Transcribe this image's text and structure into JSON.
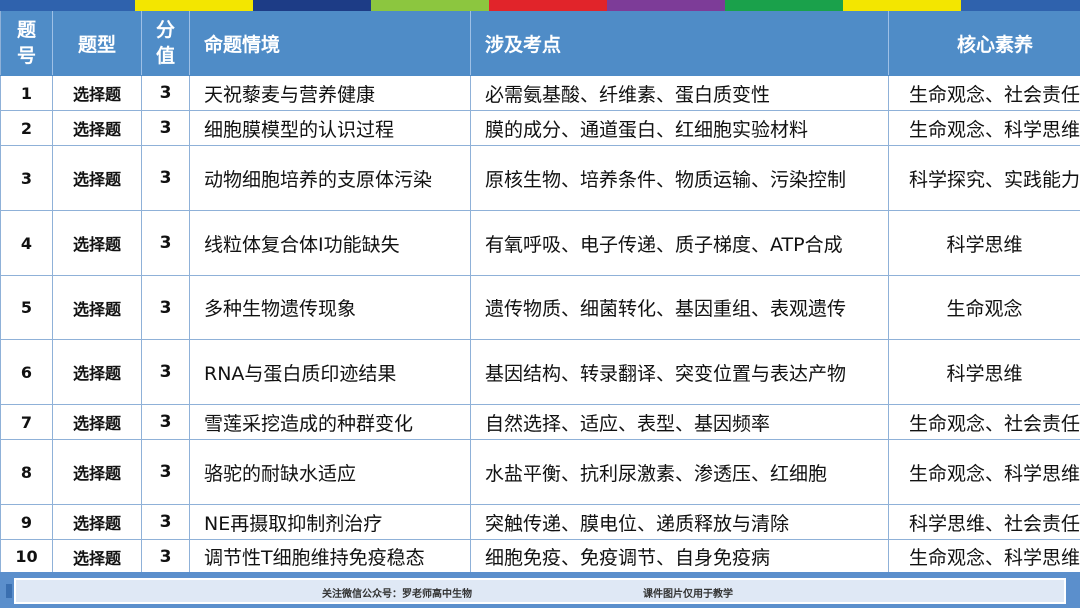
{
  "color_bar": [
    "#2f62ad",
    "#f3e600",
    "#1d3c86",
    "#8cc63f",
    "#e1242a",
    "#7d3c98",
    "#1aa14b",
    "#f3e600",
    "#2f62ad"
  ],
  "header": {
    "num": "题\n号",
    "type": "题型",
    "score": "分\n值",
    "scene": "命题情境",
    "points": "涉及考点",
    "core": "核心素养"
  },
  "rows": [
    {
      "num": "1",
      "type": "选择题",
      "score": "3",
      "scene": "天祝藜麦与营养健康",
      "points": "必需氨基酸、纤维素、蛋白质变性",
      "core": "生命观念、社会责任"
    },
    {
      "num": "2",
      "type": "选择题",
      "score": "3",
      "scene": "细胞膜模型的认识过程",
      "points": "膜的成分、通道蛋白、红细胞实验材料",
      "core": "生命观念、科学思维"
    },
    {
      "num": "3",
      "type": "选择题",
      "score": "3",
      "scene": "动物细胞培养的支原体污染",
      "points": "原核生物、培养条件、物质运输、污染控制",
      "core": "科学探究、实践能力"
    },
    {
      "num": "4",
      "type": "选择题",
      "score": "3",
      "scene": "线粒体复合体Ⅰ功能缺失",
      "points": "有氧呼吸、电子传递、质子梯度、ATP合成",
      "core": "科学思维"
    },
    {
      "num": "5",
      "type": "选择题",
      "score": "3",
      "scene": "多种生物遗传现象",
      "points": "遗传物质、细菌转化、基因重组、表观遗传",
      "core": "生命观念"
    },
    {
      "num": "6",
      "type": "选择题",
      "score": "3",
      "scene": "RNA与蛋白质印迹结果",
      "points": "基因结构、转录翻译、突变位置与表达产物",
      "core": "科学思维"
    },
    {
      "num": "7",
      "type": "选择题",
      "score": "3",
      "scene": "雪莲采挖造成的种群变化",
      "points": "自然选择、适应、表型、基因频率",
      "core": "生命观念、社会责任"
    },
    {
      "num": "8",
      "type": "选择题",
      "score": "3",
      "scene": "骆驼的耐缺水适应",
      "points": "水盐平衡、抗利尿激素、渗透压、红细胞",
      "core": "生命观念、科学思维"
    },
    {
      "num": "9",
      "type": "选择题",
      "score": "3",
      "scene": "NE再摄取抑制剂治疗",
      "points": "突触传递、膜电位、递质释放与清除",
      "core": "科学思维、社会责任"
    },
    {
      "num": "10",
      "type": "选择题",
      "score": "3",
      "scene": "调节性T细胞维持免疫稳态",
      "points": "细胞免疫、免疫调节、自身免疫病",
      "core": "生命观念、科学思维"
    }
  ],
  "footer": {
    "left": "关注微信公众号：罗老师高中生物",
    "right": "课件图片仅用于教学"
  }
}
